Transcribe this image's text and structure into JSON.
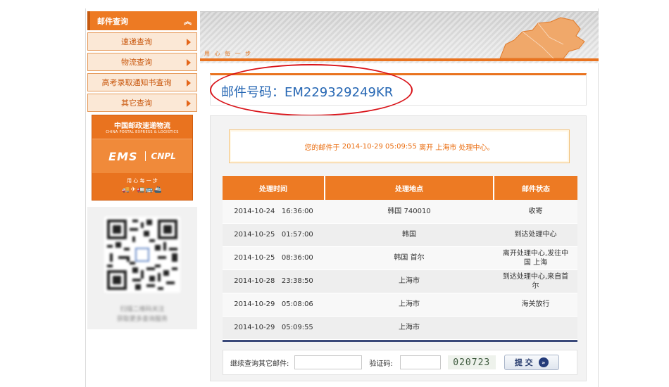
{
  "sidebar": {
    "header": "邮件查询",
    "items": [
      {
        "label": "速递查询"
      },
      {
        "label": "物流查询"
      },
      {
        "label": "高考录取通知书查询"
      },
      {
        "label": "其它查询"
      }
    ],
    "banner": {
      "company_cn": "中国邮政速递物流",
      "company_en": "CHINA POSTAL EXPRESS & LOGISTICS",
      "ems": "EMS",
      "cnpl": "CNPL",
      "slogan": "用 心 每 一 步",
      "vehicles": "🚚✈🚛🚌🚢"
    },
    "qr": {
      "line1": "扫描二维码关注",
      "line2": "获取更多查询服务"
    }
  },
  "header": {
    "slogan": "用 心 每 一 步"
  },
  "mail_number": {
    "label": "邮件号码：",
    "value": "EM229329249KR"
  },
  "summary": {
    "prefix": "您的邮件于",
    "datetime": "2014-10-29 05:09:55",
    "action": "离开",
    "place": "上海市 处理中心",
    "suffix": "。"
  },
  "table": {
    "headers": {
      "time": "处理时间",
      "location": "处理地点",
      "status": "邮件状态"
    },
    "rows": [
      {
        "date": "2014-10-24",
        "time": "16:36:00",
        "location": "韩国 740010",
        "status": "收寄"
      },
      {
        "date": "2014-10-25",
        "time": "01:57:00",
        "location": "韩国",
        "status": "到达处理中心"
      },
      {
        "date": "2014-10-25",
        "time": "08:36:00",
        "location": "韩国 首尔",
        "status": "离开处理中心,发往中国 上海"
      },
      {
        "date": "2014-10-28",
        "time": "23:38:50",
        "location": "上海市",
        "status": "到达处理中心,来自首尔"
      },
      {
        "date": "2014-10-29",
        "time": "05:08:06",
        "location": "上海市",
        "status": "海关放行"
      },
      {
        "date": "2014-10-29",
        "time": "05:09:55",
        "location": "上海市",
        "status": ""
      }
    ]
  },
  "query": {
    "continue_label": "继续查询其它邮件:",
    "mail_input_value": "",
    "captcha_label": "验证码:",
    "captcha_input_value": "",
    "captcha_code": "020723",
    "submit_label": "提 交",
    "submit_icon": "»"
  },
  "colors": {
    "accent": "#ed7a23",
    "link_blue": "#2566b3",
    "annotation_red": "#d9141a"
  }
}
